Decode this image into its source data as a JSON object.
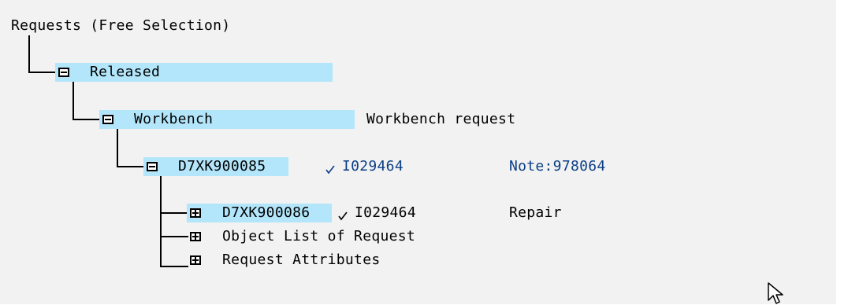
{
  "tree": {
    "root_label": "Requests (Free Selection)",
    "released": {
      "label": "Released"
    },
    "workbench": {
      "label": "Workbench",
      "description": "Workbench request"
    },
    "request": {
      "id": "D7XK900085",
      "owner": "I029464",
      "note": "Note:978064"
    },
    "task": {
      "id": "D7XK900086",
      "owner": "I029464",
      "description": "Repair"
    },
    "object_list": {
      "label": "Object List of Request"
    },
    "attributes": {
      "label": "Request Attributes"
    }
  },
  "icons": {
    "folder_open": "minus-box-icon",
    "folder_closed": "plus-box-icon",
    "status_check": "check-icon",
    "cursor": "mouse-pointer-icon"
  },
  "colors": {
    "highlight": "#b3e6fb",
    "link_blue": "#0c3f86",
    "background": "#f2f2f2"
  }
}
